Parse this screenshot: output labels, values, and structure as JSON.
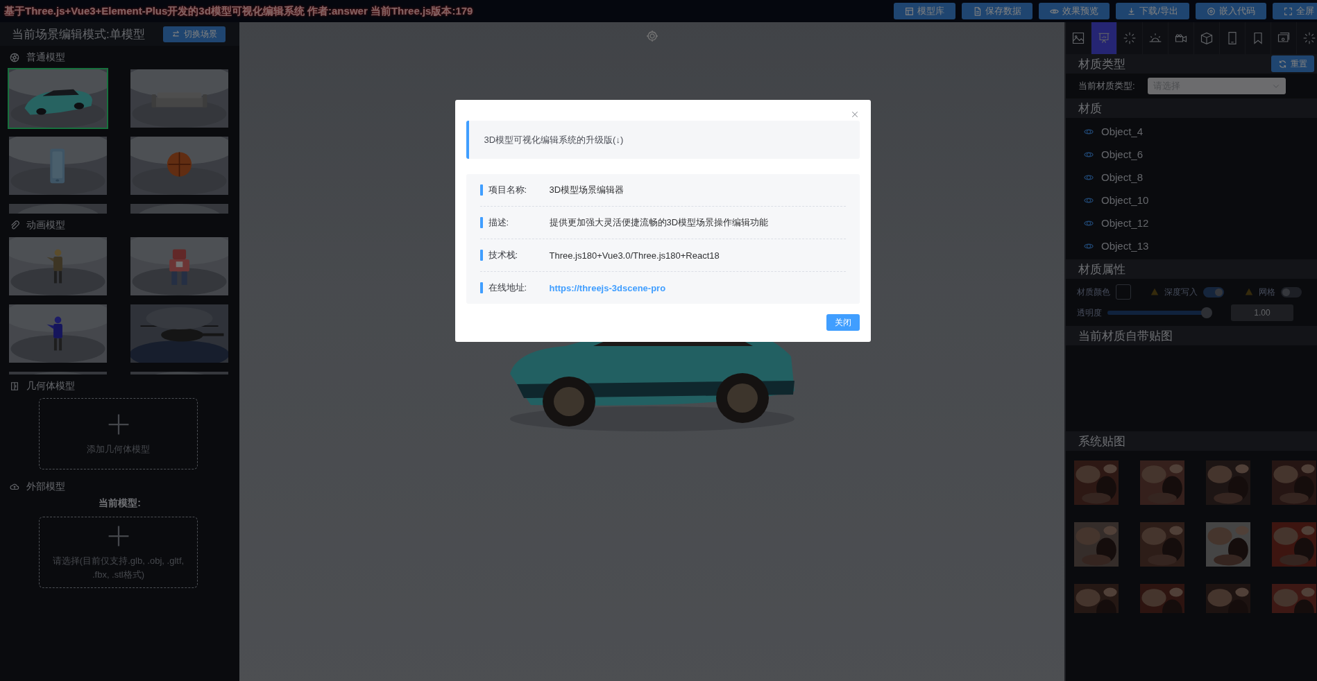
{
  "header": {
    "title": "基于Three.js+Vue3+Element-Plus开发的3d模型可视化编辑系统 作者:answer 当前Three.js版本:179",
    "buttons": [
      {
        "label": "模型库"
      },
      {
        "label": "保存数据"
      },
      {
        "label": "效果预览"
      },
      {
        "label": "下载/导出"
      },
      {
        "label": "嵌入代码"
      },
      {
        "label": "全屏"
      }
    ]
  },
  "left_panel": {
    "mode_title": "当前场景编辑模式:单模型",
    "switch_button": "切换场景",
    "sections": [
      {
        "kind": "gallery",
        "title": "普通模型",
        "items": [
          {
            "kind": "picture",
            "selected": true
          },
          {
            "kind": "picture",
            "selected": false
          },
          {
            "kind": "picture",
            "selected": false
          },
          {
            "kind": "picture",
            "selected": false
          },
          {
            "kind": "picture",
            "selected": false
          },
          {
            "kind": "picture",
            "selected": false
          }
        ]
      },
      {
        "kind": "gallery",
        "title": "动画模型",
        "items": [
          {
            "kind": "picture",
            "selected": false
          },
          {
            "kind": "picture",
            "selected": false
          },
          {
            "kind": "picture",
            "selected": false
          },
          {
            "kind": "picture",
            "selected": false
          },
          {
            "kind": "picture",
            "selected": false
          },
          {
            "kind": "picture",
            "selected": false
          }
        ]
      },
      {
        "kind": "upload",
        "title": "几何体模型",
        "upload_label": "添加几何体模型"
      },
      {
        "kind": "upload",
        "title": "外部模型",
        "caption": "当前模型:",
        "upload_label": "请选择(目前仅支持.glb, .obj, .gltf, .fbx, .stl格式)"
      }
    ]
  },
  "viewport": {
    "kind": "picture"
  },
  "modal": {
    "notice": "3D模型可视化编辑系统的升级版(↓)",
    "rows": [
      {
        "kind": "text",
        "label": "项目名称:",
        "value": "3D模型场景编辑器"
      },
      {
        "kind": "text",
        "label": "描述:",
        "value": "提供更加强大灵活便捷流畅的3D模型场景操作编辑功能"
      },
      {
        "kind": "text",
        "label": "技术栈:",
        "value": "Three.js180+Vue3.0/Three.js180+React18"
      },
      {
        "kind": "link",
        "label": "在线地址:",
        "value": "https://threejs-3dscene-pro"
      }
    ],
    "close_button": "关闭"
  },
  "right_panel": {
    "tabs": [
      {
        "selected": false
      },
      {
        "selected": true
      },
      {
        "selected": false
      },
      {
        "selected": false
      },
      {
        "selected": false
      },
      {
        "selected": false
      },
      {
        "selected": false
      },
      {
        "selected": false
      },
      {
        "selected": false
      },
      {
        "selected": false
      }
    ],
    "material_type": {
      "title": "材质类型",
      "reset_button": "重置",
      "field_label": "当前材质类型:",
      "placeholder": "请选择"
    },
    "materials": {
      "title": "材质",
      "items": [
        {
          "name": "Object_4"
        },
        {
          "name": "Object_6"
        },
        {
          "name": "Object_8"
        },
        {
          "name": "Object_10"
        },
        {
          "name": "Object_12"
        },
        {
          "name": "Object_13"
        }
      ]
    },
    "properties": {
      "title": "材质属性",
      "color_label": "材质颜色",
      "depth_write": {
        "label": "深度写入",
        "on": true
      },
      "wireframe": {
        "label": "网格",
        "on": false
      },
      "opacity": {
        "label": "透明度",
        "level": 0.95,
        "reading": "1.00"
      }
    },
    "own_textures": {
      "title": "当前材质自带贴图"
    },
    "system_textures": {
      "title": "系统贴图",
      "items": [
        {
          "kind": "picture"
        },
        {
          "kind": "picture"
        },
        {
          "kind": "picture"
        },
        {
          "kind": "picture"
        },
        {
          "kind": "picture"
        },
        {
          "kind": "picture"
        },
        {
          "kind": "picture"
        },
        {
          "kind": "picture"
        },
        {
          "kind": "picture"
        },
        {
          "kind": "picture"
        },
        {
          "kind": "picture"
        },
        {
          "kind": "picture"
        }
      ]
    }
  }
}
